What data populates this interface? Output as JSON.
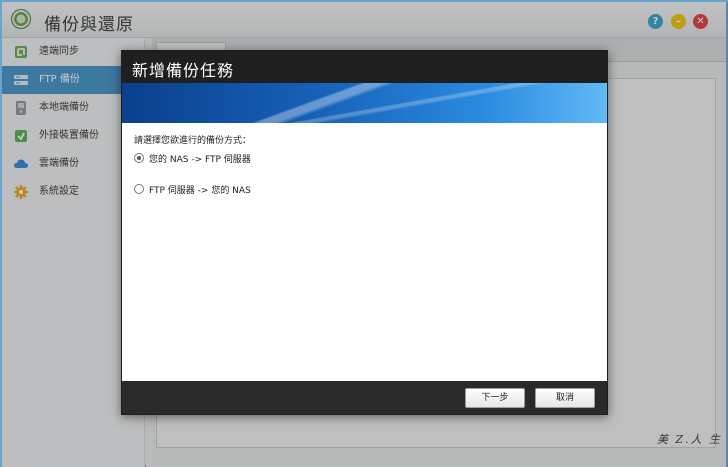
{
  "window": {
    "title": "備份與還原",
    "controls": {
      "help": "?",
      "minimize": "–",
      "close": "✕"
    }
  },
  "sidebar": {
    "items": [
      {
        "label": "遠端同步",
        "icon": "sync-icon",
        "active": false
      },
      {
        "label": "FTP 備份",
        "icon": "ftp-icon",
        "active": true
      },
      {
        "label": "本地端備份",
        "icon": "local-disk-icon",
        "active": false
      },
      {
        "label": "外接裝置備份",
        "icon": "external-device-icon",
        "active": false
      },
      {
        "label": "雲端備份",
        "icon": "cloud-icon",
        "active": false
      },
      {
        "label": "系統設定",
        "icon": "gear-icon",
        "active": false
      }
    ]
  },
  "modal": {
    "title": "新增備份任務",
    "prompt": "請選擇您欲進行的備份方式：",
    "options": [
      {
        "label": "您的 NAS -> FTP 伺服器",
        "checked": true
      },
      {
        "label": "FTP 伺服器 -> 您的 NAS",
        "checked": false
      }
    ],
    "buttons": {
      "next": "下一步",
      "cancel": "取消"
    }
  },
  "watermark": "美 Z.人 生",
  "colors": {
    "accent": "#3d8fc7",
    "modal_header": "#1f1f1f",
    "frame": "#6aa3cc"
  }
}
